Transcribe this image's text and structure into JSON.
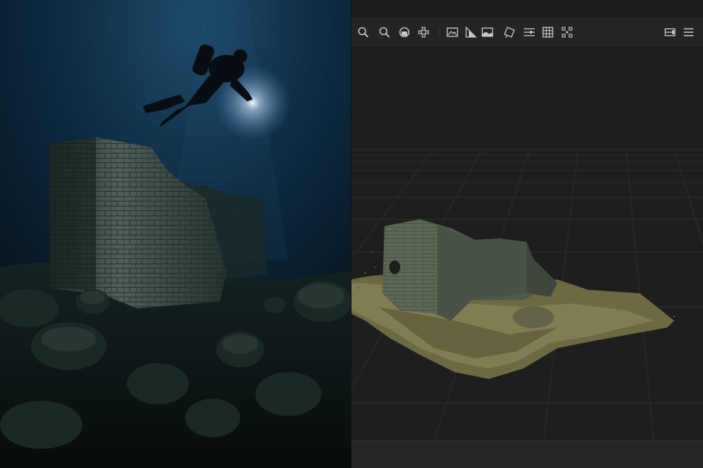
{
  "photo": {
    "scene": "diver-over-submerged-ruins"
  },
  "viewer": {
    "toolbar": {
      "left_tools": [
        {
          "name": "zoom-in",
          "icon": "magnifier-icon"
        },
        {
          "name": "zoom-out",
          "icon": "magnifier-icon"
        },
        {
          "name": "orbit",
          "icon": "orbit-icon"
        },
        {
          "name": "pan",
          "icon": "pan-icon"
        },
        {
          "name": "image",
          "icon": "image-icon"
        },
        {
          "name": "shading",
          "icon": "shading-icon"
        },
        {
          "name": "texture",
          "icon": "texture-icon"
        },
        {
          "name": "select",
          "icon": "select-icon"
        },
        {
          "name": "adjust",
          "icon": "sliders-icon"
        },
        {
          "name": "grid",
          "icon": "grid-icon"
        },
        {
          "name": "points",
          "icon": "points-icon"
        }
      ],
      "right_tools": [
        {
          "name": "panel-toggle",
          "icon": "panel-icon"
        },
        {
          "name": "menu",
          "icon": "hamburger-icon"
        }
      ]
    },
    "colors": {
      "background": "#1f1f1f",
      "toolbar": "#242424",
      "icon": "#c8c8c8",
      "grid": "#2e2e2e"
    }
  }
}
